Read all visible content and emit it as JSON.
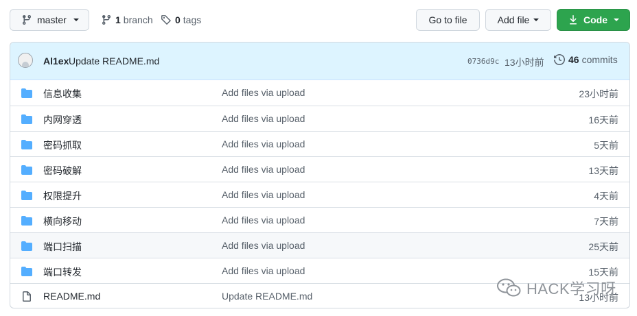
{
  "toolbar": {
    "branch_selector": {
      "label": "master",
      "icon": "git-branch-icon"
    },
    "branches": {
      "count": "1",
      "label": "branch",
      "icon": "git-branch-icon"
    },
    "tags": {
      "count": "0",
      "label": "tags",
      "icon": "tag-icon"
    },
    "goto_file_label": "Go to file",
    "add_file_label": "Add file",
    "code_label": "Code",
    "code_icon": "download-icon"
  },
  "commit": {
    "author": "Al1ex",
    "message": "Update README.md",
    "sha": "0736d9c",
    "time": "13小时前",
    "commits_count": "46",
    "commits_label": "commits",
    "history_icon": "history-icon"
  },
  "files": [
    {
      "type": "dir",
      "icon": "folder-icon",
      "name": "信息收集",
      "message": "Add files via upload",
      "age": "23小时前"
    },
    {
      "type": "dir",
      "icon": "folder-icon",
      "name": "内网穿透",
      "message": "Add files via upload",
      "age": "16天前"
    },
    {
      "type": "dir",
      "icon": "folder-icon",
      "name": "密码抓取",
      "message": "Add files via upload",
      "age": "5天前"
    },
    {
      "type": "dir",
      "icon": "folder-icon",
      "name": "密码破解",
      "message": "Add files via upload",
      "age": "13天前"
    },
    {
      "type": "dir",
      "icon": "folder-icon",
      "name": "权限提升",
      "message": "Add files via upload",
      "age": "4天前"
    },
    {
      "type": "dir",
      "icon": "folder-icon",
      "name": "横向移动",
      "message": "Add files via upload",
      "age": "7天前"
    },
    {
      "type": "dir",
      "icon": "folder-icon",
      "name": "端口扫描",
      "message": "Add files via upload",
      "age": "25天前"
    },
    {
      "type": "dir",
      "icon": "folder-icon",
      "name": "端口转发",
      "message": "Add files via upload",
      "age": "15天前"
    },
    {
      "type": "file",
      "icon": "file-icon",
      "name": "README.md",
      "message": "Update README.md",
      "age": "13小时前"
    }
  ],
  "watermark": {
    "text": "HACK学习呀",
    "icon": "wechat-icon"
  },
  "colors": {
    "primary_button": "#2da44e",
    "folder": "#54aeff",
    "commit_bar": "#ddf4ff",
    "border": "#d0d7de"
  }
}
